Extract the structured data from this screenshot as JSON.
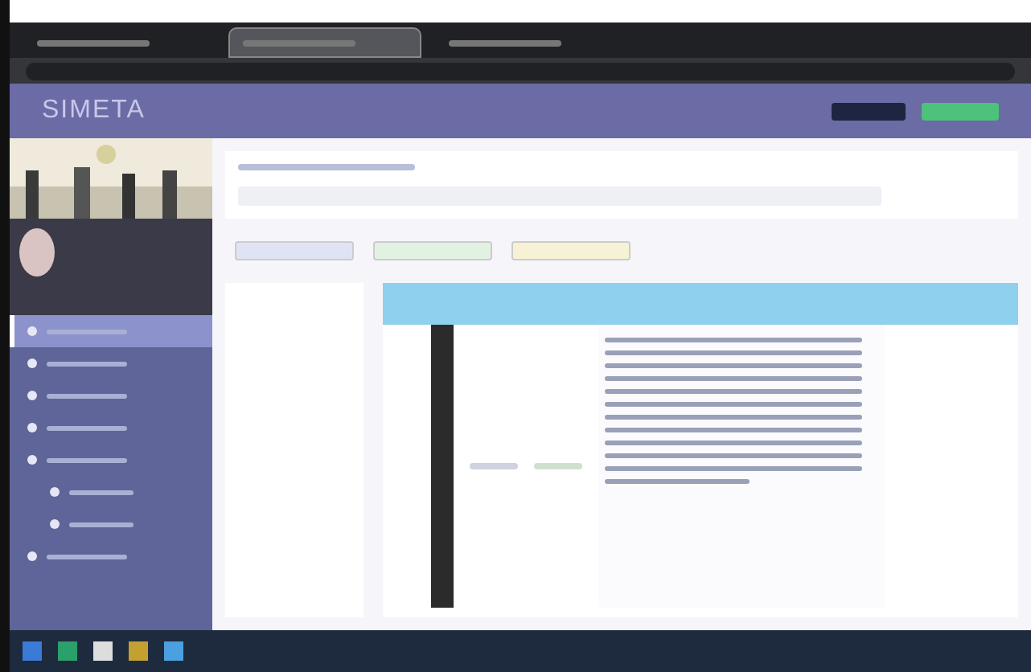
{
  "browser": {
    "tabs": [
      {
        "selected": false
      },
      {
        "selected": true
      },
      {
        "selected": false
      }
    ]
  },
  "header": {
    "logo": "SIMETA"
  },
  "sidebar": {
    "items": [
      {
        "kind": "item",
        "selected": true
      },
      {
        "kind": "item",
        "selected": false
      },
      {
        "kind": "item",
        "selected": false
      },
      {
        "kind": "item",
        "selected": false
      },
      {
        "kind": "item",
        "selected": false
      },
      {
        "kind": "subitem",
        "selected": false
      },
      {
        "kind": "subitem",
        "selected": false
      },
      {
        "kind": "item",
        "selected": false
      }
    ]
  },
  "filters": [
    {
      "color": "#dfe3f5"
    },
    {
      "color": "#e2f2e2"
    },
    {
      "color": "#f7f2d6"
    }
  ]
}
